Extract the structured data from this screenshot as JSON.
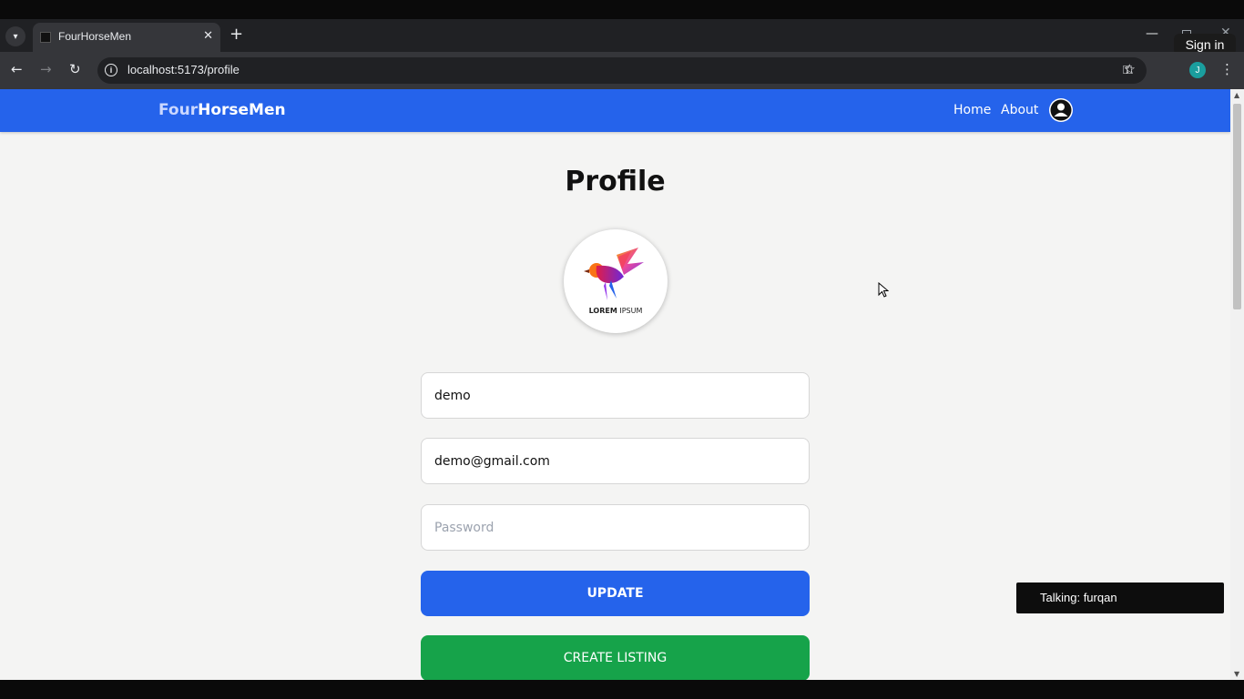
{
  "browser": {
    "tab_title": "FourHorseMen",
    "new_tab_glyph": "+",
    "tab_close_glyph": "✕",
    "url": "localhost:5173/profile",
    "profile_initial": "J",
    "signin_tooltip": "Sign in"
  },
  "app": {
    "brand_part1": "Four",
    "brand_part2": "HorseMen",
    "nav": [
      {
        "label": "Home"
      },
      {
        "label": "About"
      }
    ],
    "header_color": "#2563eb"
  },
  "profile": {
    "title": "Profile",
    "logo_text_bold": "LOREM",
    "logo_text_light": "IPSUM",
    "username_value": "demo",
    "email_value": "demo@gmail.com",
    "password_placeholder": "Password",
    "update_label": "UPDATE",
    "create_listing_label": "CREATE LISTING",
    "update_color": "#2563eb",
    "create_color": "#16a34a"
  },
  "overlay": {
    "talking_label": "Talking: furqan"
  }
}
